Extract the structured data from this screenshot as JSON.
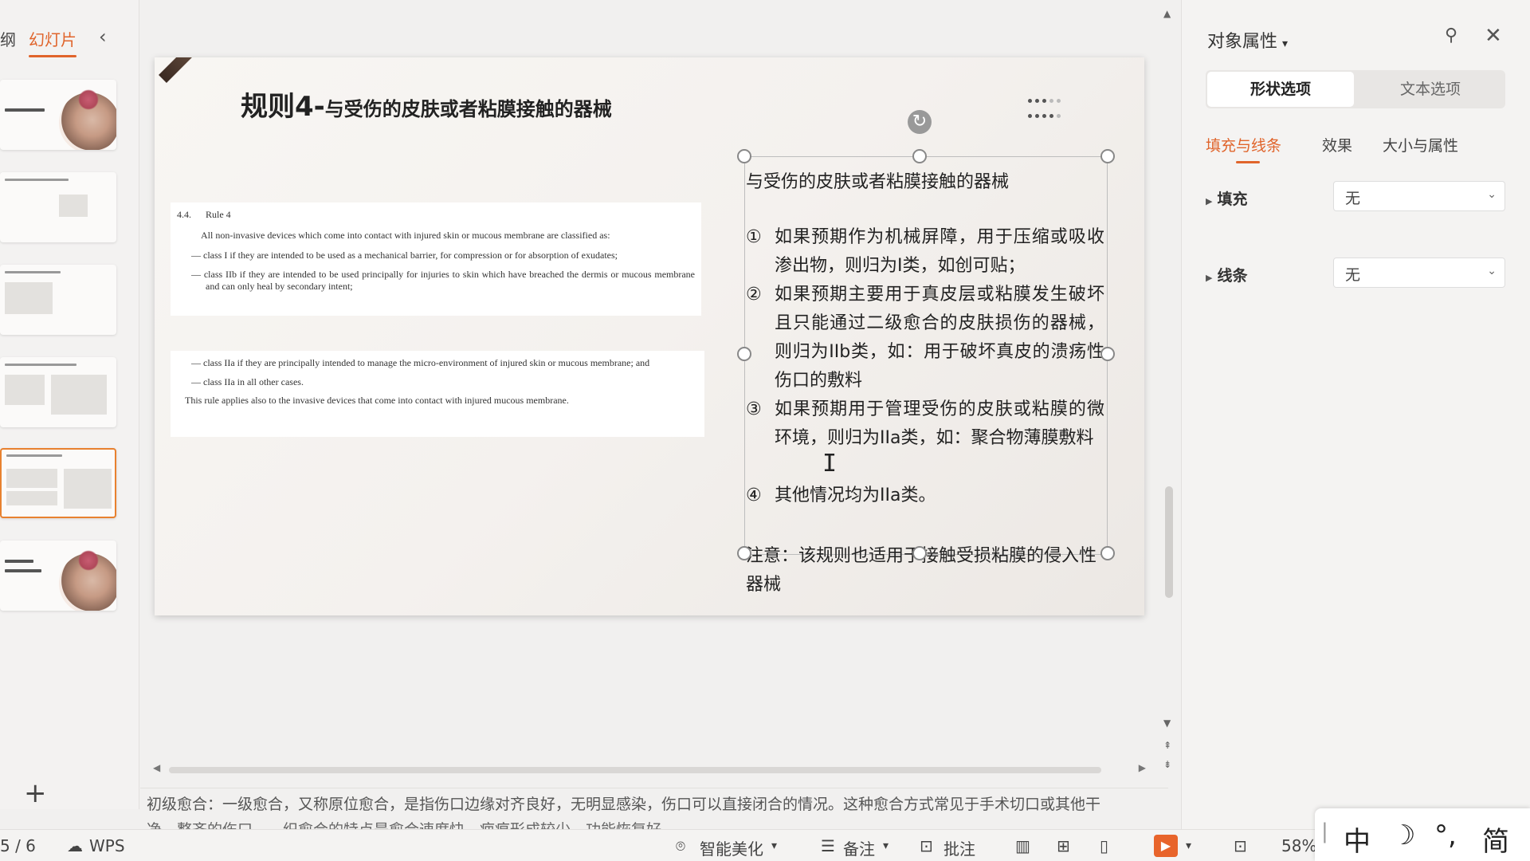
{
  "left_panel": {
    "tab_outline": "纲",
    "tab_slides": "幻灯片",
    "collapse_icon": "chevron-left",
    "add_slide": "+"
  },
  "slide": {
    "title_main": "规则4-",
    "title_sub": "与受伤的皮肤或者粘膜接触的器械",
    "doc1": {
      "num": "4.4.",
      "rule": "Rule 4",
      "intro": "All non-invasive devices which come into contact with injured skin or mucous membrane are classified as:",
      "items": [
        "— class I if they are intended to be used as a mechanical barrier, for compression or for absorption of exudates;",
        "— class IIb if they are intended to be used principally for injuries to skin which have breached the dermis or mucous membrane and can only heal by secondary intent;"
      ]
    },
    "doc2": {
      "items": [
        "— class IIa if they are principally intended to manage the micro-environment of injured skin or mucous membrane; and",
        "— class IIa in all other cases."
      ],
      "note": "This rule applies also to the invasive devices that come into contact with injured mucous membrane."
    },
    "textbox": {
      "heading": "与受伤的皮肤或者粘膜接触的器械",
      "items": [
        {
          "num": "①",
          "text": "如果预期作为机械屏障，用于压缩或吸收渗出物，则归为I类，如创可贴；"
        },
        {
          "num": "②",
          "text": "如果预期主要用于真皮层或粘膜发生破坏且只能通过二级愈合的皮肤损伤的器械，则归为IIb类，如：用于破坏真皮的溃疡性伤口的敷料"
        },
        {
          "num": "③",
          "text": "如果预期用于管理受伤的皮肤或粘膜的微环境，则归为IIa类，如：聚合物薄膜敷料"
        },
        {
          "num": "④",
          "text": "其他情况均为IIa类。"
        }
      ],
      "note": "注意：该规则也适用于接触受损粘膜的侵入性器械"
    }
  },
  "notes": {
    "line1": "初级愈合：一级愈合，又称原位愈合，是指伤口边缘对齐良好，无明显感染，伤口可以直接闭合的情况。这种愈合方式常见于手术切口或其他干",
    "line2": "净、整齐的伤口……织愈合的特点是愈合速度快，疤痕形成较少，功能恢复好。"
  },
  "right_panel": {
    "title": "对象属性",
    "seg_shape": "形状选项",
    "seg_text": "文本选项",
    "subtabs": [
      "填充与线条",
      "效果",
      "大小与属性"
    ],
    "fill_label": "填充",
    "fill_value": "无",
    "line_label": "线条",
    "line_value": "无"
  },
  "status": {
    "page": "5 / 6",
    "wps": "WPS",
    "beautify": "智能美化",
    "notes": "备注",
    "comment": "批注",
    "zoom": "58%"
  },
  "ime": {
    "mode": "中",
    "moon": "☽",
    "punct": "°,",
    "simp": "简"
  }
}
